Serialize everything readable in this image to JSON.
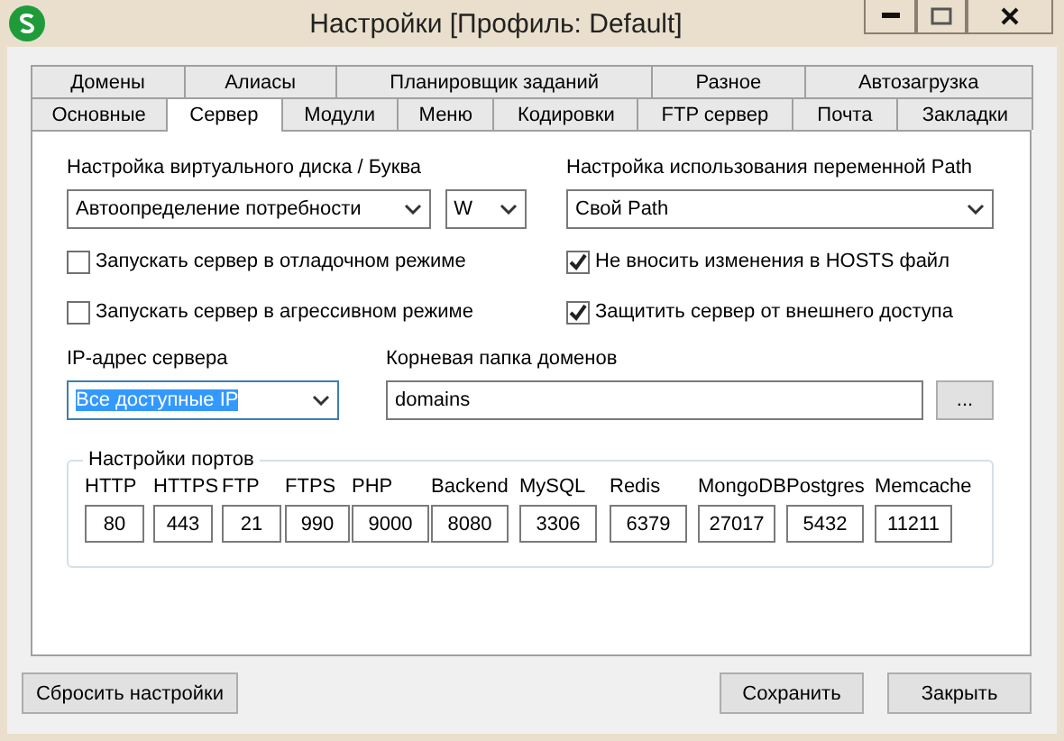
{
  "window": {
    "title": "Настройки [Профиль: Default]"
  },
  "tab_rows": [
    [
      {
        "label": "Домены",
        "selected": false
      },
      {
        "label": "Алиасы",
        "selected": false
      },
      {
        "label": "Планировщик заданий",
        "selected": false
      },
      {
        "label": "Разное",
        "selected": false
      },
      {
        "label": "Автозагрузка",
        "selected": false
      }
    ],
    [
      {
        "label": "Основные",
        "selected": false
      },
      {
        "label": "Сервер",
        "selected": true
      },
      {
        "label": "Модули",
        "selected": false
      },
      {
        "label": "Меню",
        "selected": false
      },
      {
        "label": "Кодировки",
        "selected": false
      },
      {
        "label": "FTP сервер",
        "selected": false
      },
      {
        "label": "Почта",
        "selected": false
      },
      {
        "label": "Закладки",
        "selected": false
      }
    ]
  ],
  "virtual_disk": {
    "label": "Настройка виртуального диска / Буква",
    "mode": "Автоопределение потребности",
    "letter": "W"
  },
  "path": {
    "label": "Настройка использования переменной Path",
    "value": "Свой Path"
  },
  "checkboxes": [
    {
      "label": "Запускать сервер в отладочном режиме",
      "checked": false
    },
    {
      "label": "Не вносить изменения в HOSTS файл",
      "checked": true
    },
    {
      "label": "Запускать сервер в агрессивном режиме",
      "checked": false
    },
    {
      "label": "Защитить сервер от внешнего доступа",
      "checked": true
    }
  ],
  "ip": {
    "label": "IP-адрес сервера",
    "value": "Все доступные IP",
    "text_selected": true
  },
  "root_folder": {
    "label": "Корневая папка доменов",
    "value": "domains",
    "browse": "..."
  },
  "ports": {
    "title": "Настройки портов",
    "items": [
      {
        "name": "HTTP",
        "value": "80"
      },
      {
        "name": "HTTPS",
        "value": "443"
      },
      {
        "name": "FTP",
        "value": "21"
      },
      {
        "name": "FTPS",
        "value": "990"
      },
      {
        "name": "PHP",
        "value": "9000"
      },
      {
        "name": "Backend",
        "value": "8080"
      },
      {
        "name": "MySQL",
        "value": "3306"
      },
      {
        "name": "Redis",
        "value": "6379"
      },
      {
        "name": "MongoDB",
        "value": "27017"
      },
      {
        "name": "Postgres",
        "value": "5432"
      },
      {
        "name": "Memcache",
        "value": "11211"
      }
    ]
  },
  "buttons": {
    "reset": "Сбросить настройки",
    "save": "Сохранить",
    "close": "Закрыть"
  }
}
